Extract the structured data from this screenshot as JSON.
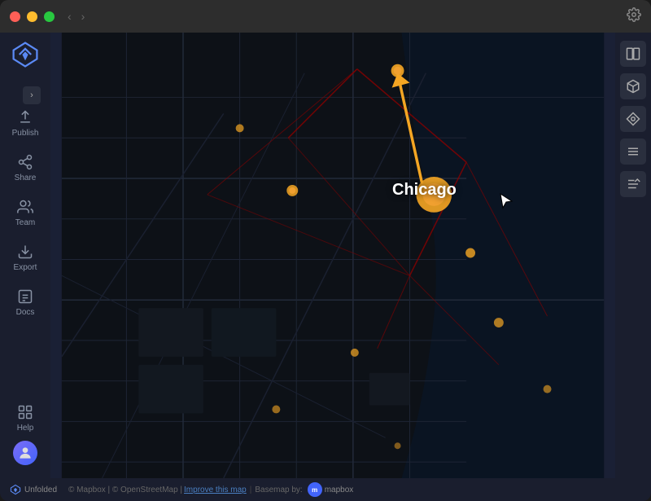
{
  "titlebar": {
    "nav_back": "‹",
    "nav_forward": "›",
    "gear_icon": "⚙"
  },
  "sidebar": {
    "logo_text": "Unfolded",
    "toggle_label": "›",
    "items": [
      {
        "id": "publish",
        "label": "Publish",
        "icon": "publish"
      },
      {
        "id": "share",
        "label": "Share",
        "icon": "share"
      },
      {
        "id": "team",
        "label": "Team",
        "icon": "team"
      },
      {
        "id": "export",
        "label": "Export",
        "icon": "export"
      },
      {
        "id": "docs",
        "label": "Docs",
        "icon": "docs"
      },
      {
        "id": "help",
        "label": "Help",
        "icon": "help"
      }
    ]
  },
  "map": {
    "city_label": "Chicago",
    "attribution": "© Mapbox | © OpenStreetMap |",
    "improve_text": "Improve this map",
    "basemap_text": "Basemap by:"
  },
  "right_toolbar": {
    "buttons": [
      {
        "id": "split-map",
        "icon": "split"
      },
      {
        "id": "3d-view",
        "icon": "cube"
      },
      {
        "id": "draw",
        "icon": "draw"
      },
      {
        "id": "layers",
        "icon": "layers"
      },
      {
        "id": "list",
        "icon": "list"
      }
    ]
  },
  "bottom_bar": {
    "brand": "Unfolded",
    "attribution": "© Mapbox | © OpenStreetMap |",
    "improve_link": "Improve this map",
    "basemap_label": "Basemap by:",
    "mapbox_label": "mapbox"
  }
}
